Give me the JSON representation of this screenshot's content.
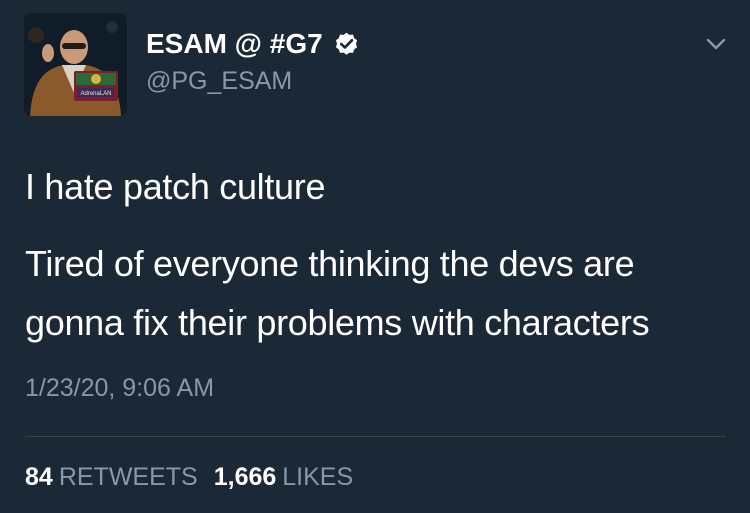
{
  "user": {
    "display_name": "ESAM @ #G7",
    "handle": "@PG_ESAM",
    "verified": true,
    "avatar_sign_text": "AdrenaLAN"
  },
  "tweet": {
    "lines": [
      "I hate patch culture",
      "Tired of everyone thinking the devs are",
      "gonna fix their problems with characters"
    ],
    "timestamp": "1/23/20, 9:06 AM"
  },
  "stats": {
    "retweets_count": "84",
    "retweets_label": "RETWEETS",
    "likes_count": "1,666",
    "likes_label": "LIKES"
  },
  "icons": {
    "verified": "verified-badge-icon",
    "menu": "chevron-down-icon"
  },
  "colors": {
    "background": "#1b2836",
    "primary_text": "#ffffff",
    "secondary_text": "#8899a6",
    "divider": "#38444d"
  }
}
